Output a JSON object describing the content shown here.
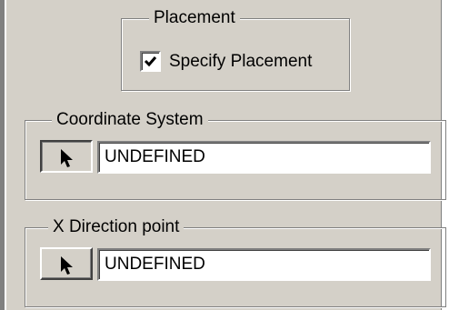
{
  "placement": {
    "legend": "Placement",
    "checkbox_label": "Specify Placement",
    "checked": true
  },
  "coordinate_system": {
    "legend": "Coordinate System",
    "value": "UNDEFINED",
    "button_icon": "arrow-cursor-icon",
    "button_pressed": true
  },
  "x_direction": {
    "legend": "X Direction point",
    "value": "UNDEFINED",
    "button_icon": "arrow-cursor-icon",
    "button_pressed": false
  }
}
